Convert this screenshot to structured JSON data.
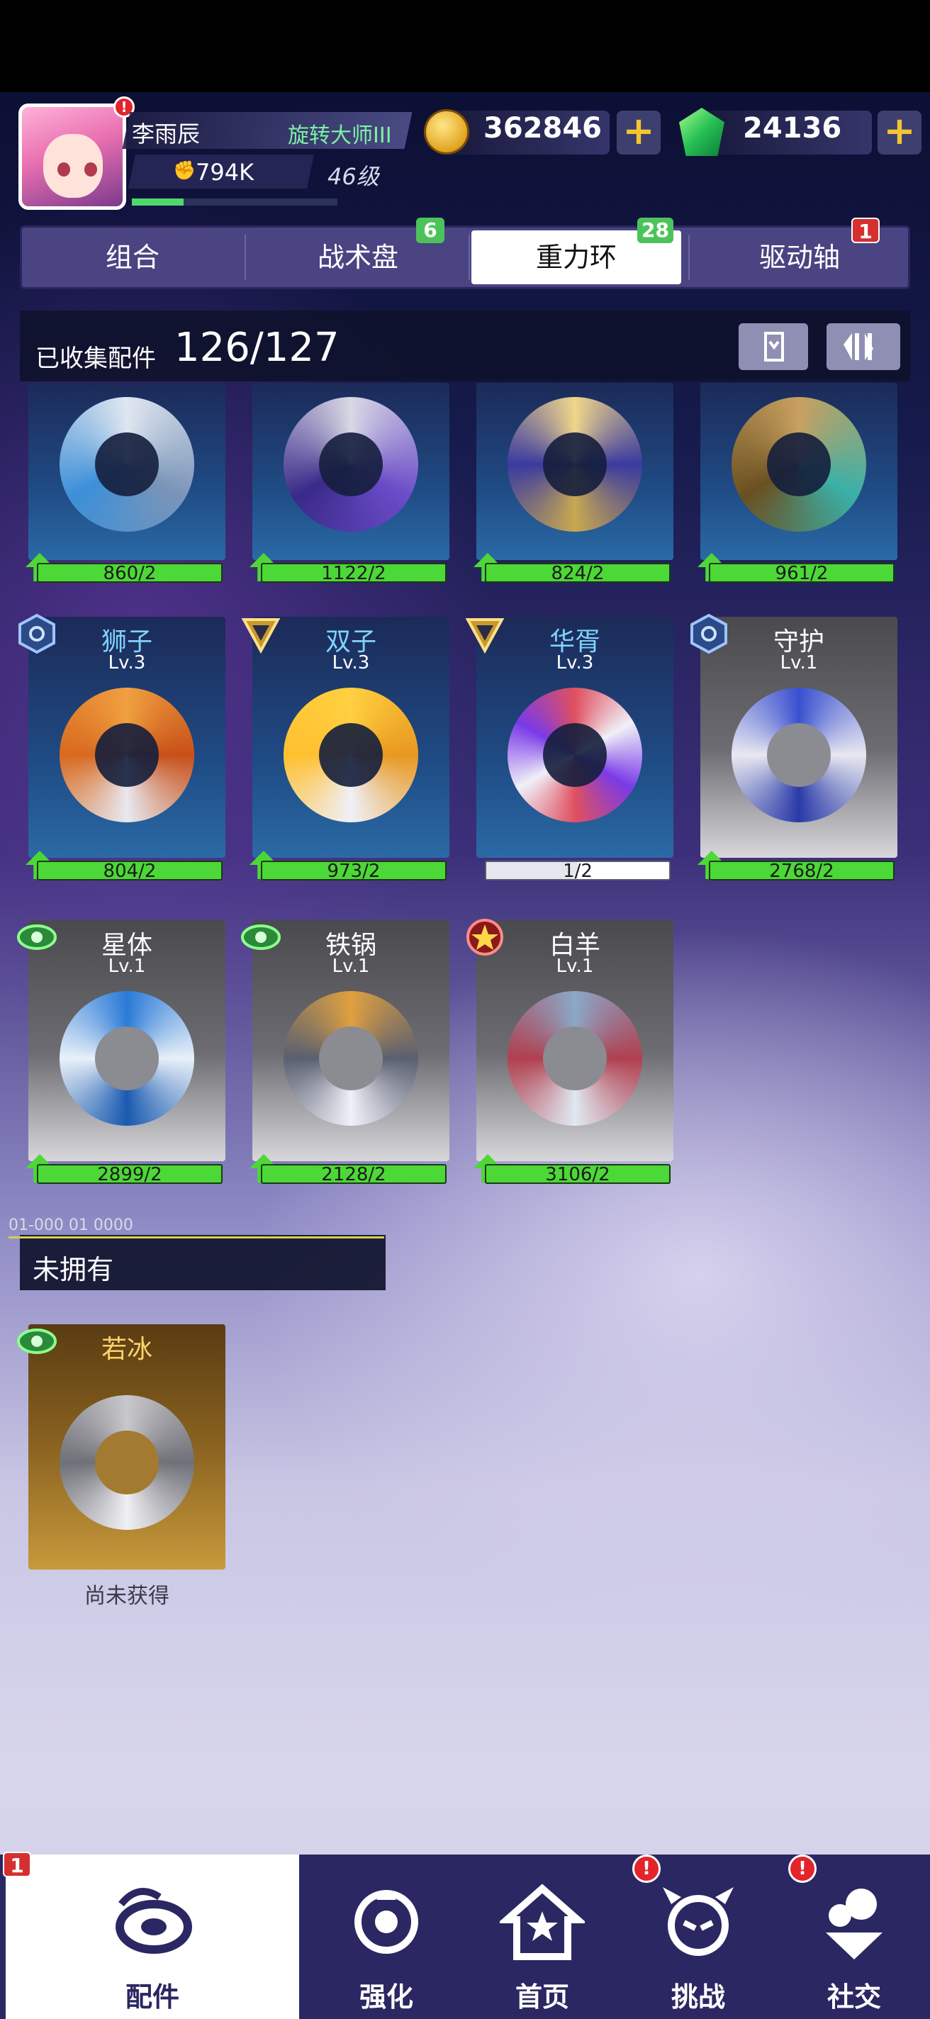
{
  "player": {
    "name": "李雨辰",
    "title": "旋转大师III",
    "power": "794K",
    "level": "46级",
    "xp_progress": 0.25
  },
  "resources": {
    "coins": "362846",
    "gems": "24136"
  },
  "tabs": [
    {
      "label": "组合",
      "badge": ""
    },
    {
      "label": "战术盘",
      "badge": "6"
    },
    {
      "label": "重力环",
      "badge": "28",
      "active": true
    },
    {
      "label": "驱动轴",
      "badge": "1"
    }
  ],
  "collection": {
    "label": "已收集配件",
    "count": "126/127"
  },
  "top_row_progress": [
    "860/2",
    "1122/2",
    "824/2",
    "961/2"
  ],
  "cards": [
    {
      "name": "狮子",
      "level": "Lv.3",
      "progress": "804/2"
    },
    {
      "name": "双子",
      "level": "Lv.3",
      "progress": "973/2"
    },
    {
      "name": "华胥",
      "level": "Lv.3",
      "progress": "1/2"
    },
    {
      "name": "守护",
      "level": "Lv.1",
      "progress": "2768/2"
    },
    {
      "name": "星体",
      "level": "Lv.1",
      "progress": "2899/2"
    },
    {
      "name": "铁锅",
      "level": "Lv.1",
      "progress": "2128/2"
    },
    {
      "name": "白羊",
      "level": "Lv.1",
      "progress": "3106/2"
    }
  ],
  "unowned": {
    "tag": "01-000 01 0000",
    "label": "未拥有",
    "card": {
      "name": "若冰",
      "status": "尚未获得"
    }
  },
  "bottom_nav": [
    {
      "label": "配件",
      "badge": "1",
      "active": true
    },
    {
      "label": "强化"
    },
    {
      "label": "首页"
    },
    {
      "label": "挑战",
      "alert": true
    },
    {
      "label": "社交",
      "alert": true
    }
  ],
  "colors": {
    "accent_green": "#4cd836",
    "nav_bg": "#2b2762",
    "tab_bg": "#4a4482"
  }
}
